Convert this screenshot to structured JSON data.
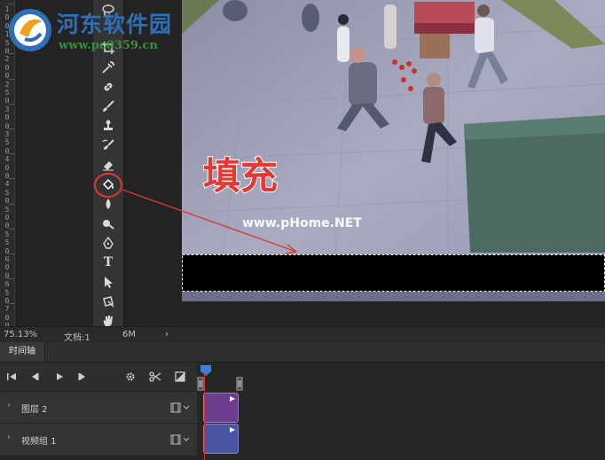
{
  "watermark": {
    "site_name": "河东软件园",
    "site_url": "www.pc0359.cn"
  },
  "ruler": {
    "labels": [
      "1",
      "0",
      "0",
      "1",
      "5",
      "0",
      "2",
      "0",
      "0",
      "2",
      "5",
      "0",
      "3",
      "0",
      "0",
      "3",
      "5",
      "0",
      "4",
      "0",
      "0",
      "4",
      "5",
      "0",
      "5",
      "0",
      "0",
      "5",
      "5",
      "0",
      "6",
      "0",
      "0",
      "6",
      "5",
      "0",
      "7",
      "0",
      "0"
    ]
  },
  "canvas": {
    "annotation_text": "填充",
    "site_watermark": "www.pHome.NET"
  },
  "tools": [
    {
      "icon": "lasso-icon"
    },
    {
      "icon": "crop-icon"
    },
    {
      "icon": "eyedropper-icon"
    },
    {
      "icon": "healing-brush-icon"
    },
    {
      "icon": "brush-icon"
    },
    {
      "icon": "clone-stamp-icon"
    },
    {
      "icon": "history-brush-icon"
    },
    {
      "icon": "eraser-icon"
    },
    {
      "icon": "paint-bucket-icon"
    },
    {
      "icon": "blur-icon"
    },
    {
      "icon": "dodge-icon"
    },
    {
      "icon": "pen-icon"
    },
    {
      "icon": "type-icon",
      "glyph": "T"
    },
    {
      "icon": "path-selection-icon"
    },
    {
      "icon": "rectangle-icon"
    },
    {
      "icon": "hand-icon"
    },
    {
      "icon": "zoom-icon"
    },
    {
      "icon": "more-tools-icon",
      "glyph": "•••"
    }
  ],
  "status": {
    "zoom": "75.13%",
    "doc_label": "文档:1",
    "doc_suffix": "6M"
  },
  "timeline": {
    "tab_label": "时间轴",
    "layers": [
      {
        "name": "图层 2",
        "clip_color": "#6b3f8e"
      },
      {
        "name": "视频组 1",
        "clip_color": "#4a54a0"
      }
    ]
  },
  "colors": {
    "accent_red": "#d83a34",
    "workspace": "#232323",
    "panel": "#343434",
    "foreground_swatch": "#000000",
    "background_swatch": "#ffffff"
  }
}
